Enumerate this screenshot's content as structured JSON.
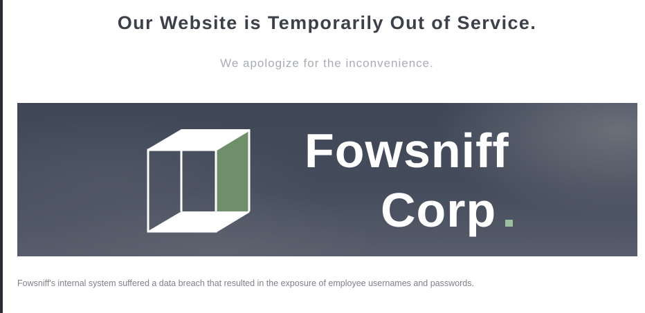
{
  "page": {
    "heading": "Our Website is Temporarily Out of Service.",
    "subheading": "We apologize for the inconvenience.",
    "notice": "Fowsniff's internal system suffered a data breach that resulted in the exposure of employee usernames and passwords."
  },
  "banner": {
    "logo_icon": "cube-icon",
    "brand_line_1": "Fowsniff",
    "brand_line_2": "Corp",
    "accent_color": "#6f8f6b",
    "dot_color": "#9dc09e"
  }
}
